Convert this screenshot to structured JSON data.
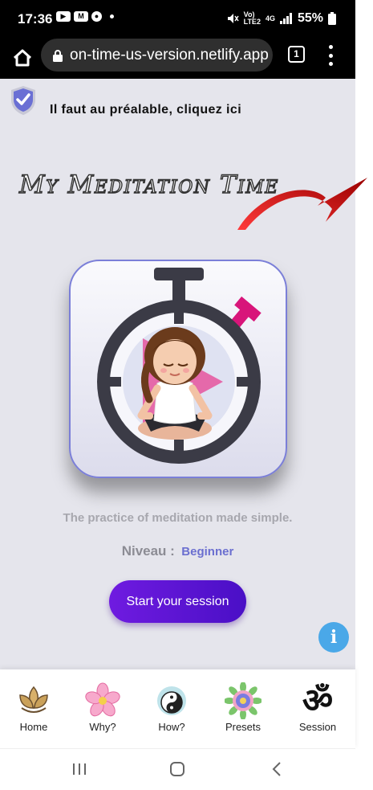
{
  "status_bar": {
    "time": "17:36",
    "network": "LTE2",
    "signal_gen": "4G",
    "battery": "55%"
  },
  "browser": {
    "url": "on-time-us-version.netlify.app",
    "tab_count": "1"
  },
  "page": {
    "prerequisite_text": "Il faut au préalable, cliquez ici",
    "app_title": "My Meditation Time",
    "tagline": "The practice of meditation made simple.",
    "level_label": "Niveau :",
    "level_value": "Beginner",
    "start_button": "Start your session",
    "info_button": "i"
  },
  "bottom_nav": {
    "items": [
      {
        "label": "Home",
        "icon": "lotus-icon"
      },
      {
        "label": "Why?",
        "icon": "flower-icon"
      },
      {
        "label": "How?",
        "icon": "yin-yang-icon"
      },
      {
        "label": "Presets",
        "icon": "mandala-icon"
      },
      {
        "label": "Session",
        "icon": "om-icon"
      }
    ]
  },
  "colors": {
    "accent": "#6f1be0",
    "level": "#6b6fd0",
    "info": "#4aa8e8",
    "arrow": "#d00f0f",
    "page_bg": "#e5e5ec"
  }
}
